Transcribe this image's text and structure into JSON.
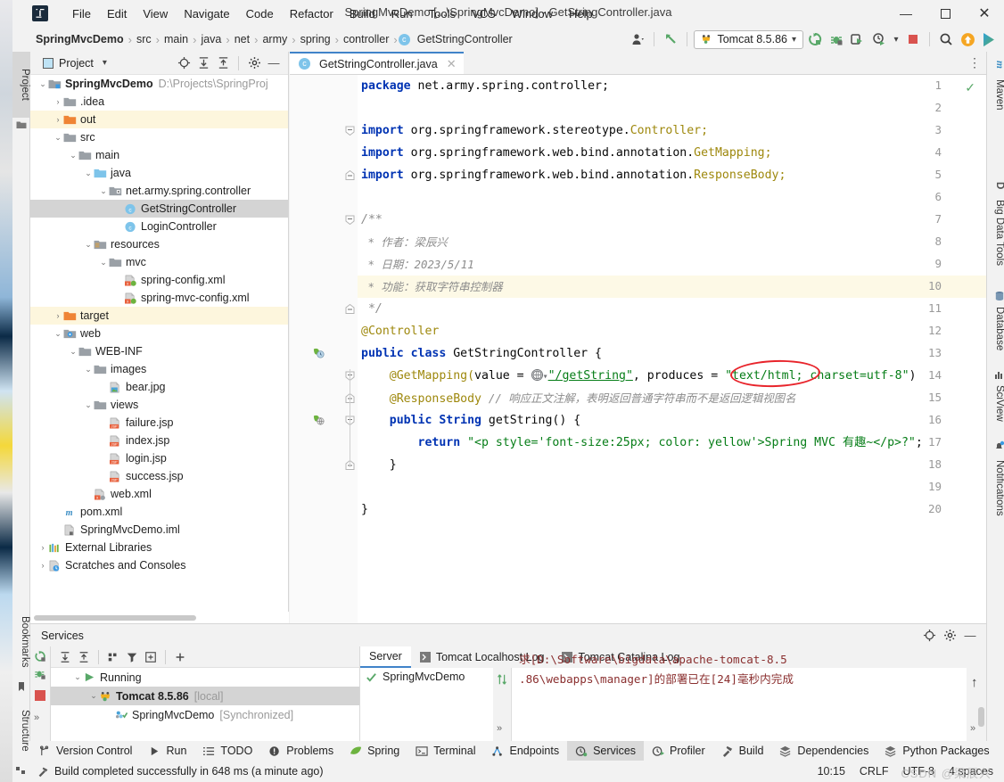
{
  "window": {
    "title": "SpringMvcDemo [...\\SpringMvcDemo] - GetStringController.java",
    "minimize": "—",
    "maximize": "☐",
    "close": "✕",
    "logo_text": "IJ"
  },
  "menubar": [
    "File",
    "Edit",
    "View",
    "Navigate",
    "Code",
    "Refactor",
    "Build",
    "Run",
    "Tools",
    "VCS",
    "Window",
    "Help"
  ],
  "breadcrumbs": [
    {
      "label": "SpringMvcDemo",
      "bold": true
    },
    {
      "label": "src",
      "bold": false
    },
    {
      "label": "main",
      "bold": false
    },
    {
      "label": "java",
      "bold": false
    },
    {
      "label": "net",
      "bold": false
    },
    {
      "label": "army",
      "bold": false
    },
    {
      "label": "spring",
      "bold": false
    },
    {
      "label": "controller",
      "bold": false
    },
    {
      "label": "GetStringController",
      "bold": false,
      "icon": "class-icon",
      "icon_letter": "c"
    }
  ],
  "toolbar": {
    "run_config": "Tomcat 8.5.86",
    "run_config_icon": "tomcat-icon",
    "dropdown_caret": "▾",
    "icons": [
      "user-icon",
      "back-arrow-icon",
      "run-icon",
      "debug-icon",
      "run-with-coverage-icon",
      "profile-icon",
      "stop-icon",
      "search-icon",
      "update-icon",
      "ide-features-icon"
    ]
  },
  "left_tabs": [
    {
      "label": "Project",
      "selected": true,
      "icon": "project-icon"
    },
    {
      "label": "Bookmarks",
      "selected": false,
      "icon": "bookmark-icon"
    },
    {
      "label": "Structure",
      "selected": false,
      "icon": "structure-icon"
    }
  ],
  "right_tabs": [
    {
      "label": "Maven",
      "icon": "maven-icon"
    },
    {
      "label": "Big Data Tools",
      "icon": "bigdata-icon"
    },
    {
      "label": "Database",
      "icon": "database-icon"
    },
    {
      "label": "SciView",
      "icon": "sciview-icon"
    },
    {
      "label": "Notifications",
      "icon": "notifications-icon"
    }
  ],
  "project_panel": {
    "title": "Project",
    "caret": "▾",
    "tools": [
      "locate-icon",
      "expand-all-icon",
      "collapse-all-icon",
      "settings-icon",
      "hide-icon"
    ],
    "tree": [
      {
        "depth": 0,
        "arrow": "⌄",
        "icon": "module-folder-icon",
        "label": "SpringMvcDemo",
        "bold": true,
        "sub": "D:\\Projects\\SpringProj",
        "state": "normal"
      },
      {
        "depth": 1,
        "arrow": "›",
        "icon": "folder-icon",
        "label": ".idea",
        "bold": false,
        "sub": "",
        "state": "normal"
      },
      {
        "depth": 1,
        "arrow": "›",
        "icon": "folder-orange-icon",
        "label": "out",
        "bold": false,
        "sub": "",
        "state": "highlight"
      },
      {
        "depth": 1,
        "arrow": "⌄",
        "icon": "folder-icon",
        "label": "src",
        "bold": false,
        "sub": "",
        "state": "normal"
      },
      {
        "depth": 2,
        "arrow": "⌄",
        "icon": "folder-icon",
        "label": "main",
        "bold": false,
        "sub": "",
        "state": "normal"
      },
      {
        "depth": 3,
        "arrow": "⌄",
        "icon": "folder-source-icon",
        "label": "java",
        "bold": false,
        "sub": "",
        "state": "normal"
      },
      {
        "depth": 4,
        "arrow": "⌄",
        "icon": "package-icon",
        "label": "net.army.spring.controller",
        "bold": false,
        "sub": "",
        "state": "normal"
      },
      {
        "depth": 5,
        "arrow": "",
        "icon": "class-icon",
        "label": "GetStringController",
        "bold": false,
        "sub": "",
        "state": "selected"
      },
      {
        "depth": 5,
        "arrow": "",
        "icon": "class-icon",
        "label": "LoginController",
        "bold": false,
        "sub": "",
        "state": "normal"
      },
      {
        "depth": 3,
        "arrow": "⌄",
        "icon": "folder-resource-icon",
        "label": "resources",
        "bold": false,
        "sub": "",
        "state": "normal"
      },
      {
        "depth": 4,
        "arrow": "⌄",
        "icon": "folder-icon",
        "label": "mvc",
        "bold": false,
        "sub": "",
        "state": "normal"
      },
      {
        "depth": 5,
        "arrow": "",
        "icon": "xml-spring-icon",
        "label": "spring-config.xml",
        "bold": false,
        "sub": "",
        "state": "normal"
      },
      {
        "depth": 5,
        "arrow": "",
        "icon": "xml-spring-icon",
        "label": "spring-mvc-config.xml",
        "bold": false,
        "sub": "",
        "state": "normal"
      },
      {
        "depth": 1,
        "arrow": "›",
        "icon": "folder-orange-icon",
        "label": "target",
        "bold": false,
        "sub": "",
        "state": "highlight"
      },
      {
        "depth": 1,
        "arrow": "⌄",
        "icon": "folder-web-icon",
        "label": "web",
        "bold": false,
        "sub": "",
        "state": "normal"
      },
      {
        "depth": 2,
        "arrow": "⌄",
        "icon": "folder-icon",
        "label": "WEB-INF",
        "bold": false,
        "sub": "",
        "state": "normal"
      },
      {
        "depth": 3,
        "arrow": "⌄",
        "icon": "folder-icon",
        "label": "images",
        "bold": false,
        "sub": "",
        "state": "normal"
      },
      {
        "depth": 4,
        "arrow": "",
        "icon": "image-file-icon",
        "label": "bear.jpg",
        "bold": false,
        "sub": "",
        "state": "normal"
      },
      {
        "depth": 3,
        "arrow": "⌄",
        "icon": "folder-icon",
        "label": "views",
        "bold": false,
        "sub": "",
        "state": "normal"
      },
      {
        "depth": 4,
        "arrow": "",
        "icon": "jsp-file-icon",
        "label": "failure.jsp",
        "bold": false,
        "sub": "",
        "state": "normal"
      },
      {
        "depth": 4,
        "arrow": "",
        "icon": "jsp-file-icon",
        "label": "index.jsp",
        "bold": false,
        "sub": "",
        "state": "normal"
      },
      {
        "depth": 4,
        "arrow": "",
        "icon": "jsp-file-icon",
        "label": "login.jsp",
        "bold": false,
        "sub": "",
        "state": "normal"
      },
      {
        "depth": 4,
        "arrow": "",
        "icon": "jsp-file-icon",
        "label": "success.jsp",
        "bold": false,
        "sub": "",
        "state": "normal"
      },
      {
        "depth": 3,
        "arrow": "",
        "icon": "xml-web-icon",
        "label": "web.xml",
        "bold": false,
        "sub": "",
        "state": "normal"
      },
      {
        "depth": 1,
        "arrow": "",
        "icon": "maven-pom-icon",
        "label": "pom.xml",
        "bold": false,
        "sub": "",
        "state": "normal"
      },
      {
        "depth": 1,
        "arrow": "",
        "icon": "iml-file-icon",
        "label": "SpringMvcDemo.iml",
        "bold": false,
        "sub": "",
        "state": "normal"
      },
      {
        "depth": 0,
        "arrow": "›",
        "icon": "libraries-icon",
        "label": "External Libraries",
        "bold": false,
        "sub": "",
        "state": "normal"
      },
      {
        "depth": 0,
        "arrow": "›",
        "icon": "scratches-icon",
        "label": "Scratches and Consoles",
        "bold": false,
        "sub": "",
        "state": "normal"
      }
    ]
  },
  "editor": {
    "tab": {
      "label": "GetStringController.java",
      "icon": "class-icon",
      "close": "✕"
    },
    "inspection_status": "✓",
    "options_icon": "more-vertical-icon",
    "lines": [
      {
        "n": "1",
        "fold": "",
        "gutter": "",
        "hl": false
      },
      {
        "n": "2",
        "fold": "",
        "gutter": "",
        "hl": false
      },
      {
        "n": "3",
        "fold": "minus",
        "gutter": "",
        "hl": false
      },
      {
        "n": "4",
        "fold": "",
        "gutter": "",
        "hl": false
      },
      {
        "n": "5",
        "fold": "end",
        "gutter": "",
        "hl": false
      },
      {
        "n": "6",
        "fold": "",
        "gutter": "",
        "hl": false
      },
      {
        "n": "7",
        "fold": "minus",
        "gutter": "",
        "hl": false
      },
      {
        "n": "8",
        "fold": "",
        "gutter": "",
        "hl": false
      },
      {
        "n": "9",
        "fold": "",
        "gutter": "",
        "hl": false
      },
      {
        "n": "10",
        "fold": "",
        "gutter": "",
        "hl": true
      },
      {
        "n": "11",
        "fold": "end",
        "gutter": "",
        "hl": false
      },
      {
        "n": "12",
        "fold": "",
        "gutter": "",
        "hl": false
      },
      {
        "n": "13",
        "fold": "",
        "gutter": "spring-bean-icon",
        "hl": false
      },
      {
        "n": "14",
        "fold": "minus",
        "gutter": "",
        "hl": false
      },
      {
        "n": "15",
        "fold": "end",
        "gutter": "",
        "hl": false
      },
      {
        "n": "16",
        "fold": "minus",
        "gutter": "spring-mapping-icon",
        "hl": false
      },
      {
        "n": "17",
        "fold": "",
        "gutter": "",
        "hl": false
      },
      {
        "n": "18",
        "fold": "end",
        "gutter": "",
        "hl": false
      },
      {
        "n": "19",
        "fold": "",
        "gutter": "",
        "hl": false
      },
      {
        "n": "20",
        "fold": "",
        "gutter": "",
        "hl": false
      }
    ],
    "code_text": {
      "l1_kw": "package",
      "l1_rest": " net.army.spring.controller;",
      "l3_kw": "import",
      "l3_pkg": " org.springframework.stereotype.",
      "l3_type": "Controller;",
      "l4_kw": "import",
      "l4_pkg": " org.springframework.web.bind.annotation.",
      "l4_type": "GetMapping;",
      "l5_kw": "import",
      "l5_pkg": " org.springframework.web.bind.annotation.",
      "l5_type": "ResponseBody;",
      "l7": "/**",
      "l8": " * 作者：梁辰兴",
      "l9": " * 日期：2023/5/11",
      "l10": " * 功能：获取字符串控制器",
      "l11": " */",
      "l12": "@Controller",
      "l13_kw": "public class ",
      "l13_name": "GetStringController {",
      "l14_an": "    @GetMapping(",
      "l14_param": "value = ",
      "l14_url": "\"/getString\"",
      "l14_mid": ", produces = ",
      "l14_str": "\"text/html; charset=utf-8\"",
      "l14_end": ")",
      "l15_an": "    @ResponseBody ",
      "l15_cm": "// 响应正文注解，表明返回普通字符串而不是返回逻辑视图名",
      "l16_kw": "    public String ",
      "l16_name": "getString() {",
      "l17_kw": "        return ",
      "l17_str": "\"<p style='font-size:25px; color: yellow'>Spring MVC 有趣~</p>?\"",
      "l17_end": ";",
      "l18": "    }",
      "l19": "}"
    },
    "annotation_ellipse": "red-ellipse-highlight",
    "annotation_color": "#e8242b"
  },
  "services": {
    "title": "Services",
    "header_tools": [
      "locate-icon",
      "settings-icon",
      "hide-icon"
    ],
    "left_icons": [
      "rerun-icon",
      "debug-icon",
      "stop-icon",
      "expand-more-icon"
    ],
    "tree_toolbar": [
      "expand-all-icon",
      "collapse-all-icon",
      "group-icon",
      "filter-icon",
      "show-icon",
      "add-icon"
    ],
    "tree": [
      {
        "depth": 0,
        "arrow": "⌄",
        "icon": "run-green-icon",
        "label": "Running",
        "bold": false,
        "sub": "",
        "state": "normal"
      },
      {
        "depth": 1,
        "arrow": "⌄",
        "icon": "tomcat-icon",
        "label": "Tomcat 8.5.86",
        "bold": true,
        "sub": "[local]",
        "state": "selected"
      },
      {
        "depth": 2,
        "arrow": "",
        "icon": "artifact-check-icon",
        "label": "SpringMvcDemo",
        "bold": false,
        "sub": "[Synchronized]",
        "state": "normal"
      }
    ],
    "tabs": [
      {
        "label": "Server",
        "selected": true,
        "icon": ""
      },
      {
        "label": "Tomcat Localhost Log",
        "selected": false,
        "icon": "console-icon"
      },
      {
        "label": "Tomcat Catalina Log",
        "selected": false,
        "icon": "console-icon"
      }
    ],
    "deploy_item": {
      "label": "SpringMvcDemo",
      "status_icon": "check-green-icon"
    },
    "console_lines": [
      "求[D:\\Software\\bigdata\\apache-tomcat-8.5",
      ".86\\webapps\\manager]的部署已在[24]毫秒内完成"
    ],
    "console_scroll_icon": "scroll-up-icon",
    "console_more": "»"
  },
  "status_tabs": [
    {
      "label": "Version Control",
      "icon": "branch-icon",
      "selected": false
    },
    {
      "label": "Run",
      "icon": "run-icon",
      "selected": false
    },
    {
      "label": "TODO",
      "icon": "todo-icon",
      "selected": false
    },
    {
      "label": "Problems",
      "icon": "problems-icon",
      "selected": false
    },
    {
      "label": "Spring",
      "icon": "spring-leaf-icon",
      "selected": false
    },
    {
      "label": "Terminal",
      "icon": "terminal-icon",
      "selected": false
    },
    {
      "label": "Endpoints",
      "icon": "endpoints-icon",
      "selected": false
    },
    {
      "label": "Services",
      "icon": "services-icon",
      "selected": true
    },
    {
      "label": "Profiler",
      "icon": "profiler-icon",
      "selected": false
    },
    {
      "label": "Build",
      "icon": "build-hammer-icon",
      "selected": false
    },
    {
      "label": "Dependencies",
      "icon": "dependencies-icon",
      "selected": false
    },
    {
      "label": "Python Packages",
      "icon": "python-packages-icon",
      "selected": false
    }
  ],
  "statusbar": {
    "message": "Build completed successfully in 648 ms (a minute ago)",
    "message_icon": "build-hammer-icon",
    "caret_position": "10:15",
    "line_separator": "CRLF",
    "encoding": "UTF-8",
    "indent": "4 spaces",
    "watermark": "CSDN @梁辰兴"
  }
}
